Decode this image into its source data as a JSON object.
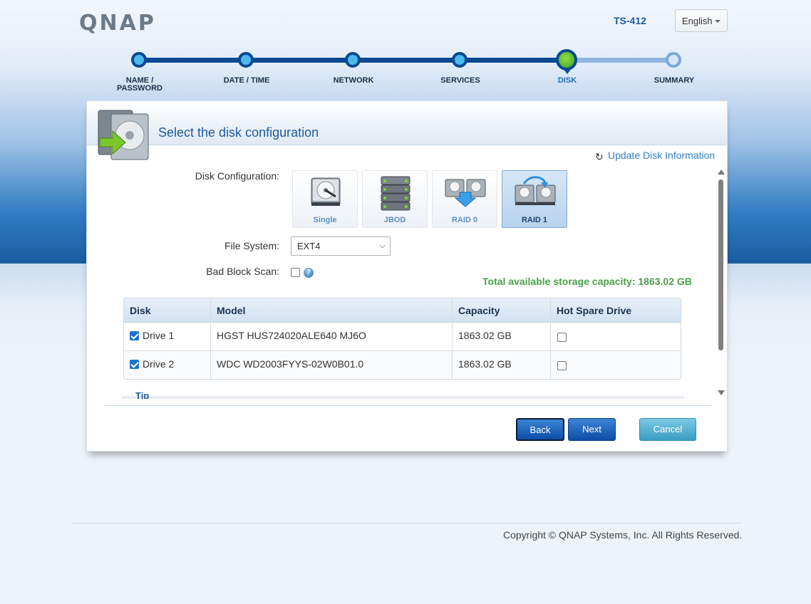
{
  "header": {
    "logo_text": "QNAP",
    "model": "TS-412",
    "language": "English"
  },
  "wizard": {
    "steps": [
      {
        "label_line1": "NAME /",
        "label_line2": "PASSWORD",
        "state": "done"
      },
      {
        "label_line1": "DATE / TIME",
        "label_line2": "",
        "state": "done"
      },
      {
        "label_line1": "NETWORK",
        "label_line2": "",
        "state": "done"
      },
      {
        "label_line1": "SERVICES",
        "label_line2": "",
        "state": "done"
      },
      {
        "label_line1": "DISK",
        "label_line2": "",
        "state": "current"
      },
      {
        "label_line1": "SUMMARY",
        "label_line2": "",
        "state": "future"
      }
    ]
  },
  "panel": {
    "title": "Select the disk configuration",
    "update_link": "Update Disk Information",
    "disk_config_label": "Disk Configuration:",
    "configs": [
      {
        "label": "Single",
        "icon": "single-disk-icon",
        "selected": false
      },
      {
        "label": "JBOD",
        "icon": "jbod-stack-icon",
        "selected": false
      },
      {
        "label": "RAID 0",
        "icon": "raid0-icon",
        "selected": false
      },
      {
        "label": "RAID 1",
        "icon": "raid1-icon",
        "selected": true
      }
    ],
    "file_system_label": "File System:",
    "file_system_value": "EXT4",
    "bad_block_label": "Bad Block Scan:",
    "bad_block_checked": false,
    "total_capacity": "Total available storage capacity: 1863.02 GB",
    "table": {
      "headers": [
        "Disk",
        "Model",
        "Capacity",
        "Hot Spare Drive"
      ],
      "rows": [
        {
          "disk": "Drive 1",
          "checked": true,
          "model": "HGST HUS724020ALE640 MJ6O",
          "capacity": "1863.02 GB",
          "hot_spare": false
        },
        {
          "disk": "Drive 2",
          "checked": true,
          "model": "WDC WD2003FYYS-02W0B01.0",
          "capacity": "1863.02 GB",
          "hot_spare": false
        }
      ]
    },
    "tip_label": "Tip",
    "buttons": {
      "back": "Back",
      "next": "Next",
      "cancel": "Cancel"
    }
  },
  "footer": {
    "copyright": "Copyright © QNAP Systems, Inc. All Rights Reserved."
  },
  "colors": {
    "accent": "#1e5aa0",
    "capacity_green": "#4aa04a",
    "step_done": "#4cb9ec",
    "step_current": "#5cc22a"
  }
}
